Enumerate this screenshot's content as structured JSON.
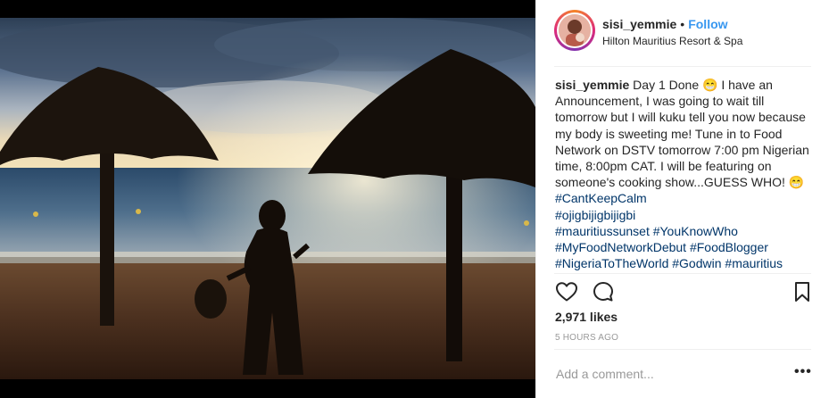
{
  "header": {
    "username": "sisi_yemmie",
    "separator": "•",
    "follow_label": "Follow",
    "location": "Hilton Mauritius Resort & Spa"
  },
  "caption": {
    "username": "sisi_yemmie",
    "text": " Day 1 Done 😁  I have an Announcement, I was going to wait till tomorrow but I will kuku tell you now because my body is sweeting me! Tune in to Food Network on DSTV tomorrow 7:00 pm Nigerian time, 8:00pm CAT. I will be featuring on someone's cooking show...GUESS WHO! 😁 ",
    "hashtags": [
      "#CantKeepCalm",
      "#ojigbijigbijigbi",
      "#mauritiussunset",
      "#YouKnowWho",
      "#MyFoodNetworkDebut",
      "#FoodBlogger",
      "#NigeriaToTheWorld",
      "#Godwin",
      "#mauritius"
    ]
  },
  "actions": {
    "like_icon": "heart-outline-icon",
    "comment_icon": "comment-bubble-icon",
    "save_icon": "bookmark-icon"
  },
  "likes": "2,971 likes",
  "time": "5 HOURS AGO",
  "comment": {
    "placeholder": "Add a comment...",
    "more_label": "•••"
  },
  "colors": {
    "follow": "#3897f0",
    "hashtag": "#003569",
    "muted": "#999999",
    "divider": "#efefef"
  }
}
